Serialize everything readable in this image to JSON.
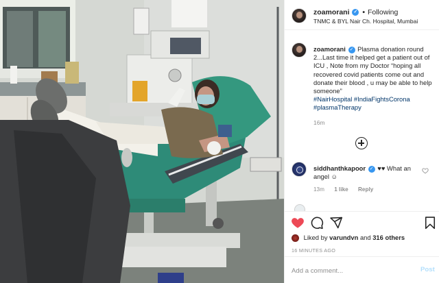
{
  "header": {
    "username": "zoamorani",
    "separator": "•",
    "follow_state": "Following",
    "location": "TNMC & BYL Nair Ch. Hospital, Mumbai"
  },
  "caption": {
    "username": "zoamorani",
    "text": "Plasma donation round 2...Last time it helped get a patient out of ICU , Note from my Doctor “hoping all recovered covid patients come out and donate their blood , u may be able to help someone”",
    "hashtags": [
      "#NairHospital #IndiaFightsCorona",
      "#plasmaTherapy"
    ],
    "time": "16m"
  },
  "comment": {
    "username": "siddhanthkapoor",
    "text": "♥♥ What an angel ☺",
    "time": "13m",
    "likes": "1 like",
    "reply": "Reply"
  },
  "likes": {
    "prefix": "Liked by",
    "user": "varundvn",
    "conjunction": "and",
    "others": "316 others"
  },
  "post_age": "16 MINUTES AGO",
  "comment_box": {
    "placeholder": "Add a comment...",
    "post_label": "Post"
  },
  "colors": {
    "accent": "#3897f0",
    "like_red": "#ed4956",
    "hashtag": "#003569",
    "muted": "#8e8e8e"
  },
  "icons": {
    "load_more": "plus-circle-icon",
    "like": "heart-filled-icon",
    "comment": "speech-bubble-icon",
    "share": "paper-plane-icon",
    "save": "bookmark-icon",
    "verified": "verified-badge-icon"
  }
}
